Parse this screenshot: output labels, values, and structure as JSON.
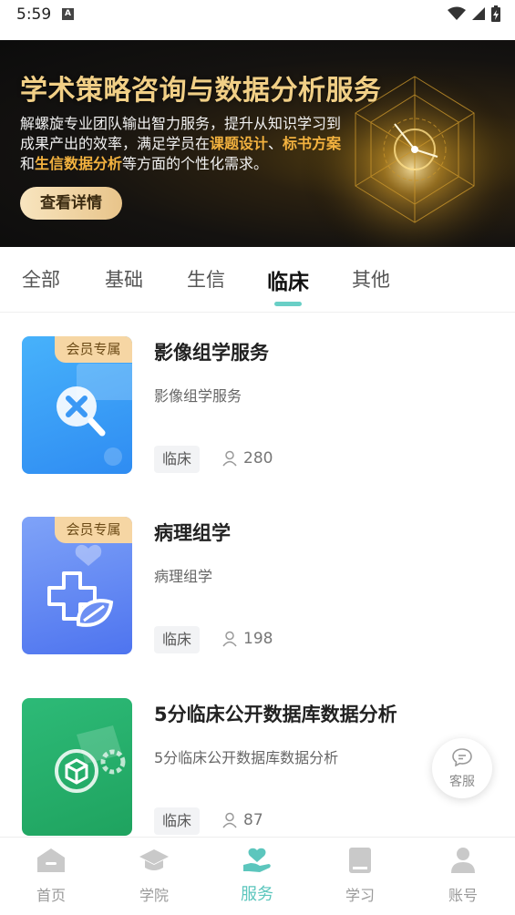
{
  "status_bar": {
    "time": "5:59",
    "notification_letter": "A",
    "icons": [
      "wifi-icon",
      "signal-icon",
      "battery-charging-icon"
    ]
  },
  "banner": {
    "title": "学术策略咨询与数据分析服务",
    "desc_1": "解螺旋专业团队输出智力服务，提升从知识学习到成果产出的效率，满足学员在",
    "desc_hl_1": "课题设计",
    "desc_2": "、",
    "desc_hl_2": "标书方案",
    "desc_3": "和",
    "desc_hl_3": "生信数据分析",
    "desc_4": "等方面的个性化需求。",
    "button_label": "查看详情"
  },
  "tabs": [
    {
      "label": "全部",
      "active": false
    },
    {
      "label": "基础",
      "active": false
    },
    {
      "label": "生信",
      "active": false
    },
    {
      "label": "临床",
      "active": true
    },
    {
      "label": "其他",
      "active": false
    }
  ],
  "services": [
    {
      "badge": "会员专属",
      "title": "影像组学服务",
      "subtitle": "影像组学服务",
      "tag": "临床",
      "count": "280",
      "thumb_color": "#3d9cf7",
      "icon": "magnifier-x-icon"
    },
    {
      "badge": "会员专属",
      "title": "病理组学",
      "subtitle": "病理组学",
      "tag": "临床",
      "count": "198",
      "thumb_color": "#5b86f3",
      "icon": "medical-cross-leaf-icon"
    },
    {
      "badge": "",
      "title": "5分临床公开数据库数据分析",
      "subtitle": "5分临床公开数据库数据分析",
      "tag": "临床",
      "count": "87",
      "thumb_color": "#27b16b",
      "icon": "cube-gear-icon"
    }
  ],
  "float_service": {
    "label": "客服",
    "icon": "chat-bubble-icon"
  },
  "bottom_nav": [
    {
      "label": "首页",
      "icon": "home-icon",
      "active": false
    },
    {
      "label": "学院",
      "icon": "graduation-cap-icon",
      "active": false
    },
    {
      "label": "服务",
      "icon": "hand-heart-icon",
      "active": true
    },
    {
      "label": "学习",
      "icon": "book-icon",
      "active": false
    },
    {
      "label": "账号",
      "icon": "user-icon",
      "active": false
    }
  ],
  "colors": {
    "accent": "#5cc6bd",
    "badge_bg": "#f6d6a4",
    "banner_gold": "#f1cf86",
    "banner_highlight": "#f3b23f"
  }
}
